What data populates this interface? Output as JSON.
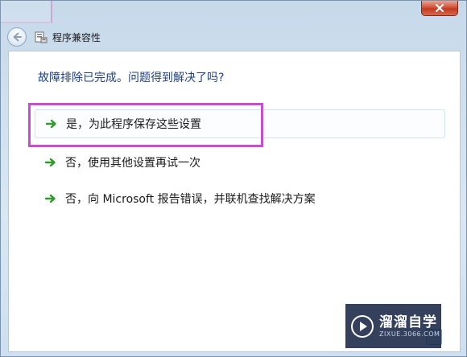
{
  "window": {
    "title": "程序兼容性"
  },
  "content": {
    "heading": "故障排除已完成。问题得到解决了吗?",
    "options": [
      {
        "label": "是，为此程序保存这些设置"
      },
      {
        "label": "否，使用其他设置再试一次"
      },
      {
        "label": "否，向 Microsoft 报告错误，并联机查找解决方案"
      }
    ]
  },
  "watermark": {
    "title": "溜溜自学",
    "subtitle": "ZIXUE.3066.COM"
  },
  "colors": {
    "heading": "#1e3f8a",
    "arrow": "#2e9a2e",
    "highlight": "#c74fcf",
    "close_button": "#c23a20"
  },
  "icons": {
    "back": "back-arrow-icon",
    "app": "program-compatibility-icon",
    "close": "close-icon",
    "option_arrow": "green-arrow-icon"
  }
}
